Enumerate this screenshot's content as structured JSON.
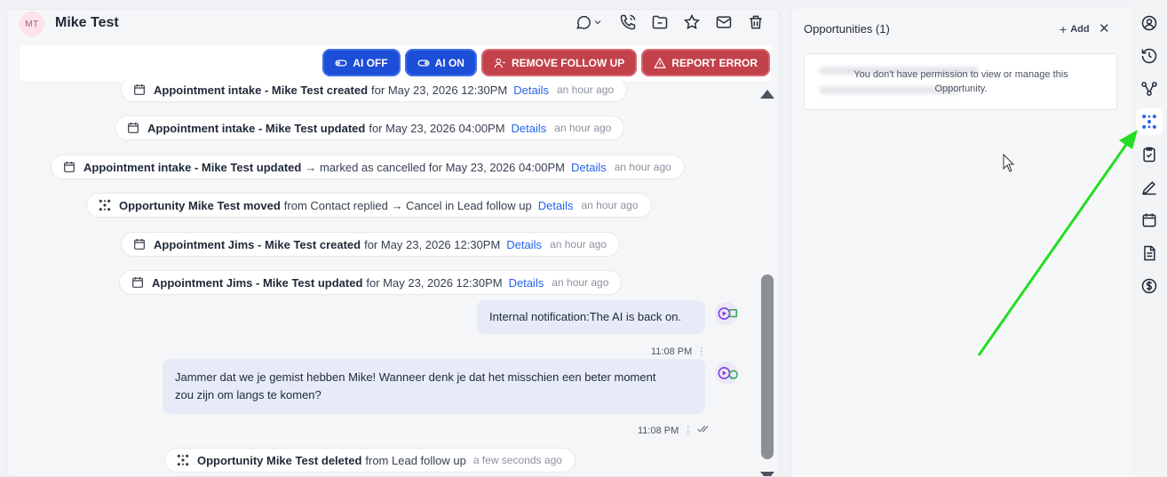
{
  "contact": {
    "initials": "MT",
    "name": "Mike Test"
  },
  "header_icons": [
    "chat-dropdown-icon",
    "phone-icon",
    "folder-icon",
    "star-icon",
    "mail-icon",
    "trash-icon"
  ],
  "toolbar": {
    "ai_off": "AI OFF",
    "ai_on": "AI ON",
    "remove_follow_up": "REMOVE FOLLOW UP",
    "report_error": "REPORT ERROR"
  },
  "activities": [
    {
      "title": "Appointment intake - Mike Test created",
      "text": "for May 23, 2026 12:30PM",
      "details": "Details",
      "ago": "an hour ago",
      "icon": "calendar-icon"
    },
    {
      "title": "Appointment intake - Mike Test updated",
      "text": "for May 23, 2026 04:00PM",
      "details": "Details",
      "ago": "an hour ago",
      "icon": "calendar-icon"
    },
    {
      "title": "Appointment intake - Mike Test updated",
      "text": "→ marked as cancelled for May 23, 2026 04:00PM",
      "details": "Details",
      "ago": "an hour ago",
      "icon": "calendar-icon"
    },
    {
      "title": "Opportunity Mike Test moved",
      "text": "from Contact replied → Cancel in Lead follow up",
      "details": "Details",
      "ago": "an hour ago",
      "icon": "opportunity-icon"
    },
    {
      "title": "Appointment Jims - Mike Test created",
      "text": "for May 23, 2026 12:30PM",
      "details": "Details",
      "ago": "an hour ago",
      "icon": "calendar-icon"
    },
    {
      "title": "Appointment Jims - Mike Test updated",
      "text": "for May 23, 2026 12:30PM",
      "details": "Details",
      "ago": "an hour ago",
      "icon": "calendar-icon"
    }
  ],
  "messages": [
    {
      "text": "Internal notification:The AI is back on.",
      "time": "11:08 PM",
      "channel": "internal-note-icon"
    },
    {
      "text_line1": "Jammer dat we je gemist hebben Mike! Wanneer denk je dat het misschien een beter moment",
      "text_line2": "zou zijn om langs te komen?",
      "time": "11:08 PM",
      "channel": "whatsapp-icon"
    }
  ],
  "last_activity": {
    "title": "Opportunity Mike Test deleted",
    "text": "from Lead follow up",
    "ago": "a few seconds ago",
    "icon": "opportunity-icon"
  },
  "opportunities": {
    "title": "Opportunities (1)",
    "add_label": "Add",
    "close_glyph": "✕",
    "permission_message_line1": "You don't have permission to view or manage this",
    "permission_message_line2": "Opportunity."
  },
  "rail_icons": [
    "user-circle-icon",
    "history-icon",
    "workflow-icon",
    "opportunity-icon",
    "tasks-icon",
    "notes-icon",
    "calendar-icon",
    "document-icon",
    "payments-icon"
  ],
  "colors": {
    "brand_blue": "#1d4ed8",
    "danger_red": "#c2414b",
    "link_blue": "#2563eb",
    "annotation_arrow": "#22dd22"
  }
}
